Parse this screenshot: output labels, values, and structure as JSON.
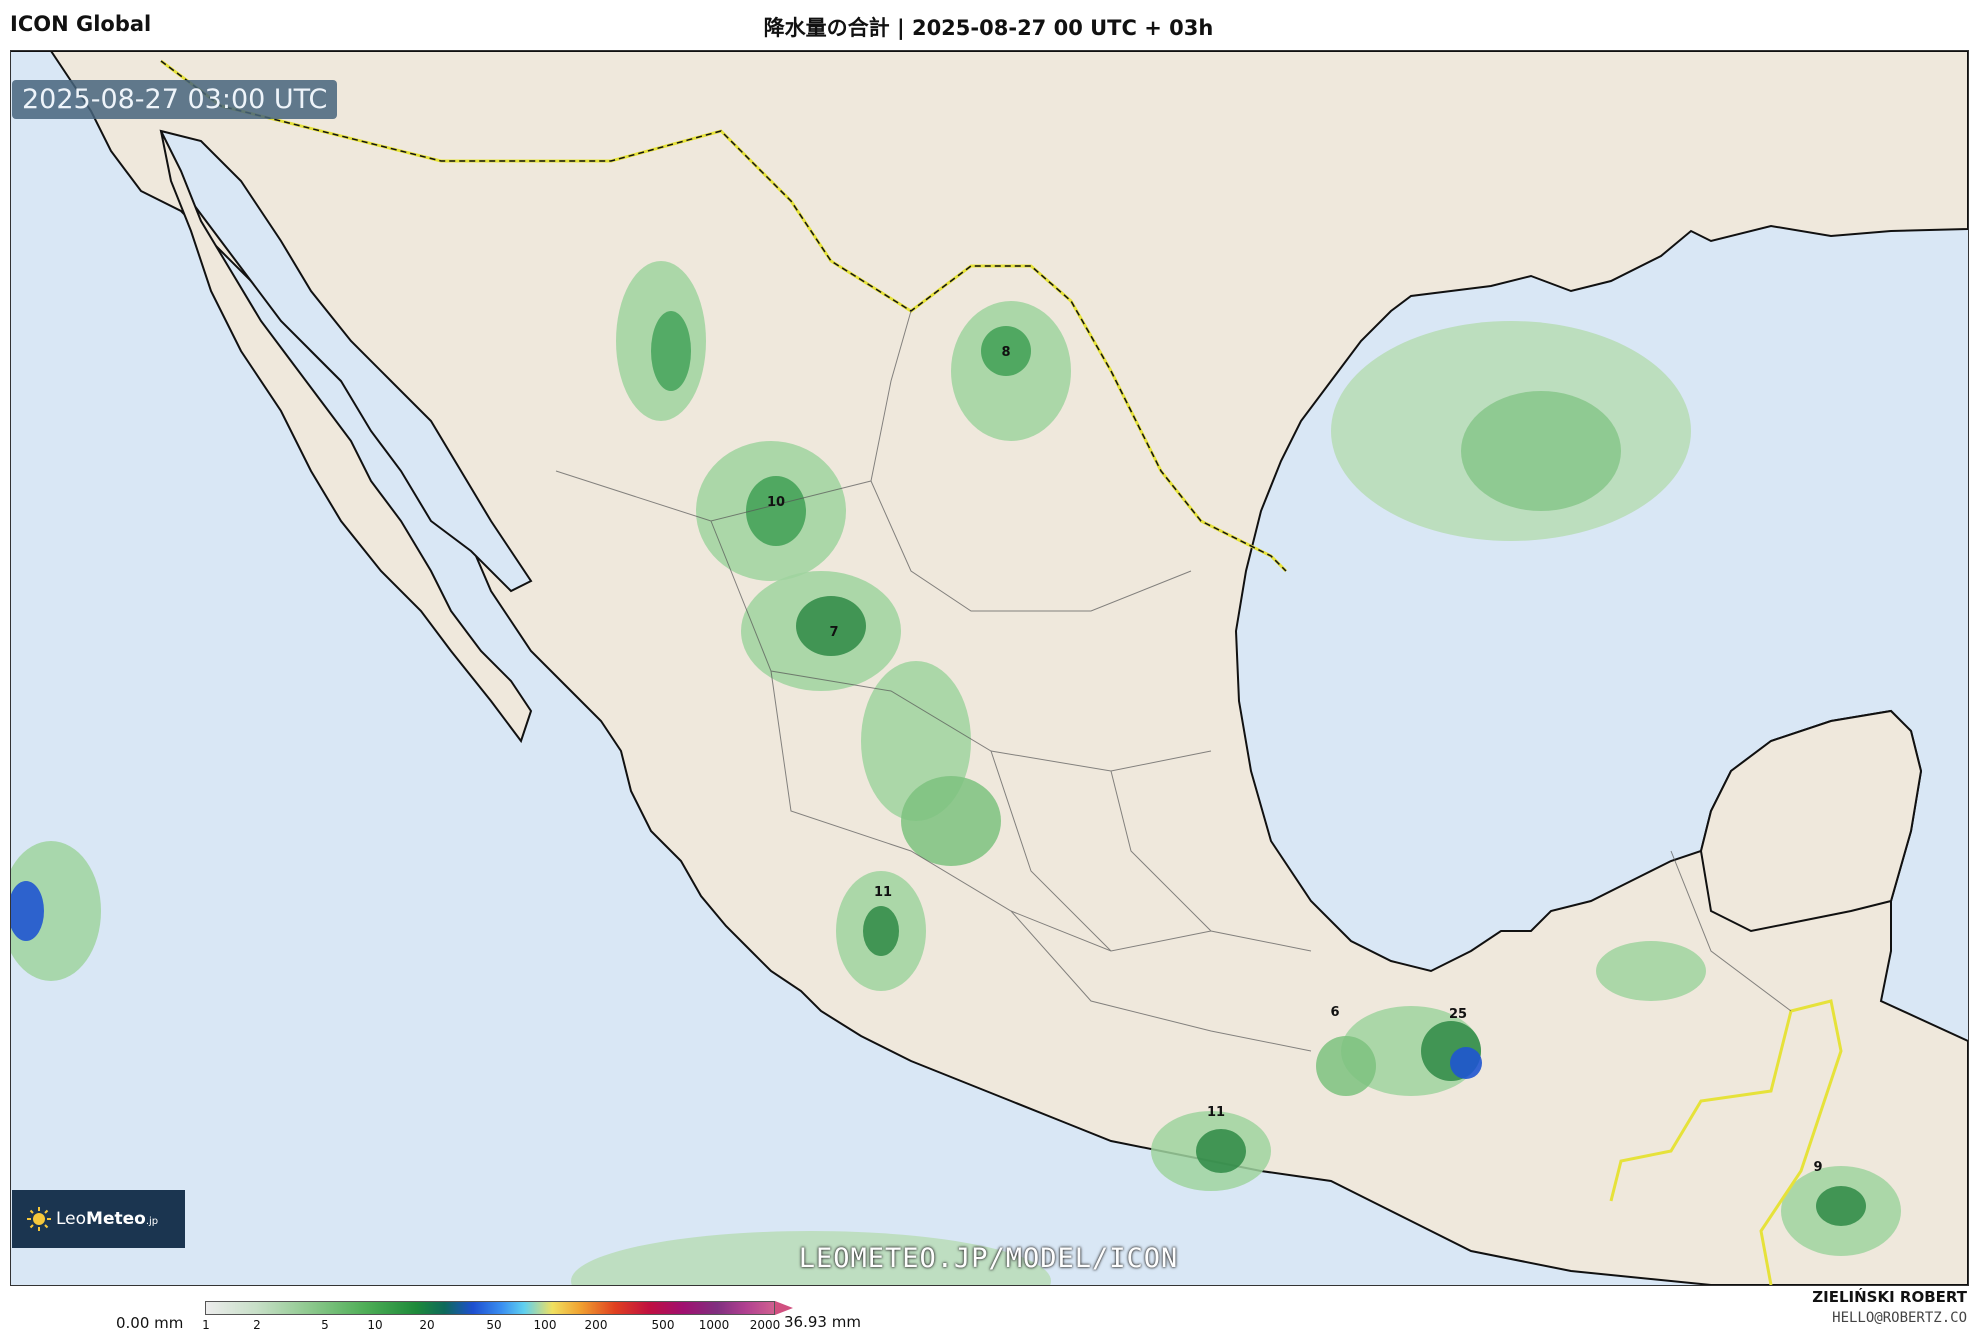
{
  "header": {
    "model": "ICON Global",
    "title": "降水量の合計 | 2025-08-27 00 UTC + 03h"
  },
  "map": {
    "valid_time": "2025-08-27 03:00 UTC",
    "watermark": "LEOMETEO.JP/MODEL/ICON",
    "logo_text_a": "Leo",
    "logo_text_b": "Meteo",
    "logo_suffix": ".jp",
    "precip_labels": [
      "8",
      "10",
      "7",
      "11",
      "6",
      "25",
      "11",
      "9"
    ],
    "colors": {
      "ocean": "#d9e7f5",
      "land": "#efe8dc",
      "precip_light": "#9fd39f",
      "precip_mid": "#3fa055",
      "precip_heavy": "#1f7a35",
      "precip_max": "#1f55d0",
      "border": "#e6e23a"
    }
  },
  "legend": {
    "min_label": "0.00 mm",
    "max_label": "36.93 mm",
    "ticks": [
      "1",
      "2",
      "5",
      "10",
      "20",
      "50",
      "100",
      "200",
      "500",
      "1000",
      "2000"
    ]
  },
  "credits": {
    "author": "ZIELIŃSKI ROBERT",
    "email": "HELLO@ROBERTZ.CO"
  }
}
